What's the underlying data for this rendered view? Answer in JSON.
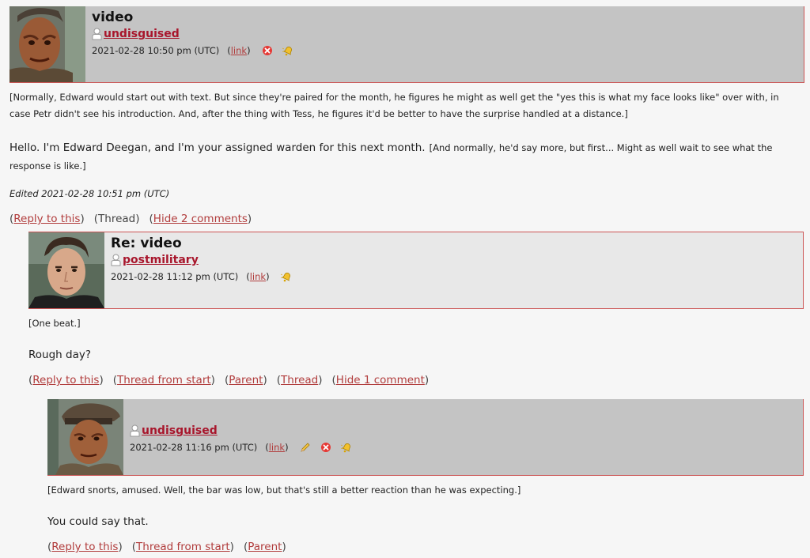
{
  "comments": [
    {
      "title": "video",
      "username": "undisguised",
      "timestamp": "2021-02-28 10:50 pm (UTC)",
      "link_label": "link",
      "icons": [
        "delete-icon",
        "bell-icon"
      ],
      "body_parts": [
        "[Normally, Edward would start out with text. But since they're paired for the month, he figures he might as well get the \"yes this is what my face looks like\" over with, in case Petr didn't see his introduction. And, after the thing with Tess, he figures it'd be better to have the surprise handled at a distance.]",
        "Hello. I'm Edward Deegan, and I'm your assigned warden for this next month.",
        "[And normally, he'd say more, but first... Might as well wait to see what the response is like.]"
      ],
      "edited": "Edited 2021-02-28 10:51 pm (UTC)",
      "actions": [
        "Reply to this",
        "Thread",
        "Hide 2 comments"
      ]
    },
    {
      "title": "Re: video",
      "username": "postmilitary",
      "timestamp": "2021-02-28 11:12 pm (UTC)",
      "link_label": "link",
      "icons": [
        "bell-icon"
      ],
      "body_parts": [
        "[One beat.]",
        "Rough day?"
      ],
      "actions": [
        "Reply to this",
        "Thread from start",
        "Parent",
        "Thread",
        "Hide 1 comment"
      ]
    },
    {
      "title": "",
      "username": "undisguised",
      "timestamp": "2021-02-28 11:16 pm (UTC)",
      "link_label": "link",
      "icons": [
        "edit-icon",
        "delete-icon",
        "bell-icon"
      ],
      "body_parts": [
        "[Edward snorts, amused. Well, the bar was low, but that's still a better reaction than he was expecting.]",
        "You could say that."
      ],
      "actions": [
        "Reply to this",
        "Thread from start",
        "Parent"
      ]
    }
  ],
  "colors": {
    "link": "#b13c3c",
    "username": "#a8162c",
    "header_dark": "#c4c4c4",
    "header_light": "#e8e8e8",
    "border": "#cc5555"
  }
}
